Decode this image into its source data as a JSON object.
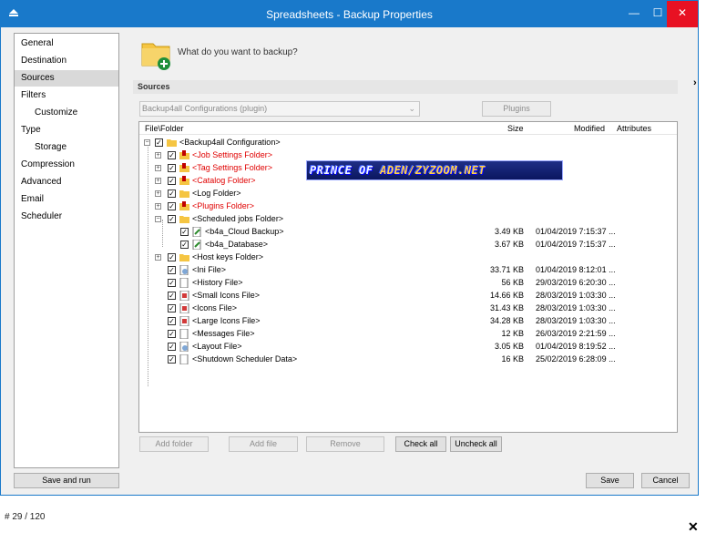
{
  "window": {
    "title": "Spreadsheets - Backup Properties",
    "min_icon": "minimize-icon",
    "max_icon": "maximize-icon",
    "close_icon": "close-icon"
  },
  "nav": {
    "items": [
      {
        "label": "General"
      },
      {
        "label": "Destination"
      },
      {
        "label": "Sources",
        "selected": true
      },
      {
        "label": "Filters"
      },
      {
        "label": "Customize"
      },
      {
        "label": "Type"
      },
      {
        "label": "Storage"
      },
      {
        "label": "Compression"
      },
      {
        "label": "Advanced"
      },
      {
        "label": "Email"
      },
      {
        "label": "Scheduler"
      }
    ],
    "save_and_run": "Save and run"
  },
  "header": {
    "question": "What do you want to backup?",
    "section": "Sources"
  },
  "sources": {
    "combo_value": "Backup4all Configurations (plugin)",
    "plugins_button": "Plugins"
  },
  "tree": {
    "columns": [
      "File\\Folder",
      "Size",
      "Modified",
      "Attributes"
    ],
    "rows": [
      {
        "name": "<Backup4all Configuration>",
        "size": "",
        "modified": ""
      },
      {
        "name": "<Job Settings Folder>",
        "size": "",
        "modified": ""
      },
      {
        "name": "<Tag Settings Folder>",
        "size": "",
        "modified": ""
      },
      {
        "name": "<Catalog Folder>",
        "size": "",
        "modified": ""
      },
      {
        "name": "<Log Folder>",
        "size": "",
        "modified": ""
      },
      {
        "name": "<Plugins Folder>",
        "size": "",
        "modified": ""
      },
      {
        "name": "<Scheduled jobs Folder>",
        "size": "",
        "modified": ""
      },
      {
        "name": "<b4a_Cloud Backup>",
        "size": "3.49 KB",
        "modified": "01/04/2019 7:15:37 ..."
      },
      {
        "name": "<b4a_Database>",
        "size": "3.67 KB",
        "modified": "01/04/2019 7:15:37 ..."
      },
      {
        "name": "<Host keys Folder>",
        "size": "",
        "modified": ""
      },
      {
        "name": "<Ini File>",
        "size": "33.71 KB",
        "modified": "01/04/2019 8:12:01 ..."
      },
      {
        "name": "<History File>",
        "size": "56 KB",
        "modified": "29/03/2019 6:20:30 ..."
      },
      {
        "name": "<Small Icons File>",
        "size": "14.66 KB",
        "modified": "28/03/2019 1:03:30 ..."
      },
      {
        "name": "<Icons File>",
        "size": "31.43 KB",
        "modified": "28/03/2019 1:03:30 ..."
      },
      {
        "name": "<Large Icons File>",
        "size": "34.28 KB",
        "modified": "28/03/2019 1:03:30 ..."
      },
      {
        "name": "<Messages File>",
        "size": "12 KB",
        "modified": "26/03/2019 2:21:59 ..."
      },
      {
        "name": "<Layout File>",
        "size": "3.05 KB",
        "modified": "01/04/2019 8:19:52 ..."
      },
      {
        "name": "<Shutdown Scheduler Data>",
        "size": "16 KB",
        "modified": "25/02/2019 6:28:09 ..."
      }
    ]
  },
  "buttons": {
    "add_folder": "Add folder",
    "add_file": "Add file",
    "remove": "Remove",
    "check_all": "Check all",
    "uncheck_all": "Uncheck all",
    "save": "Save",
    "cancel": "Cancel"
  },
  "watermark": {
    "text_a": "PRINCE OF ",
    "text_b": "ADEN/ZYZOOM.NET"
  },
  "footer": {
    "counter": "# 29 / 120",
    "close": "✕"
  },
  "colors": {
    "titlebar": "#1979ca",
    "close": "#e81123",
    "red_item": "#e00000",
    "selected_nav": "#d9d9d9"
  }
}
